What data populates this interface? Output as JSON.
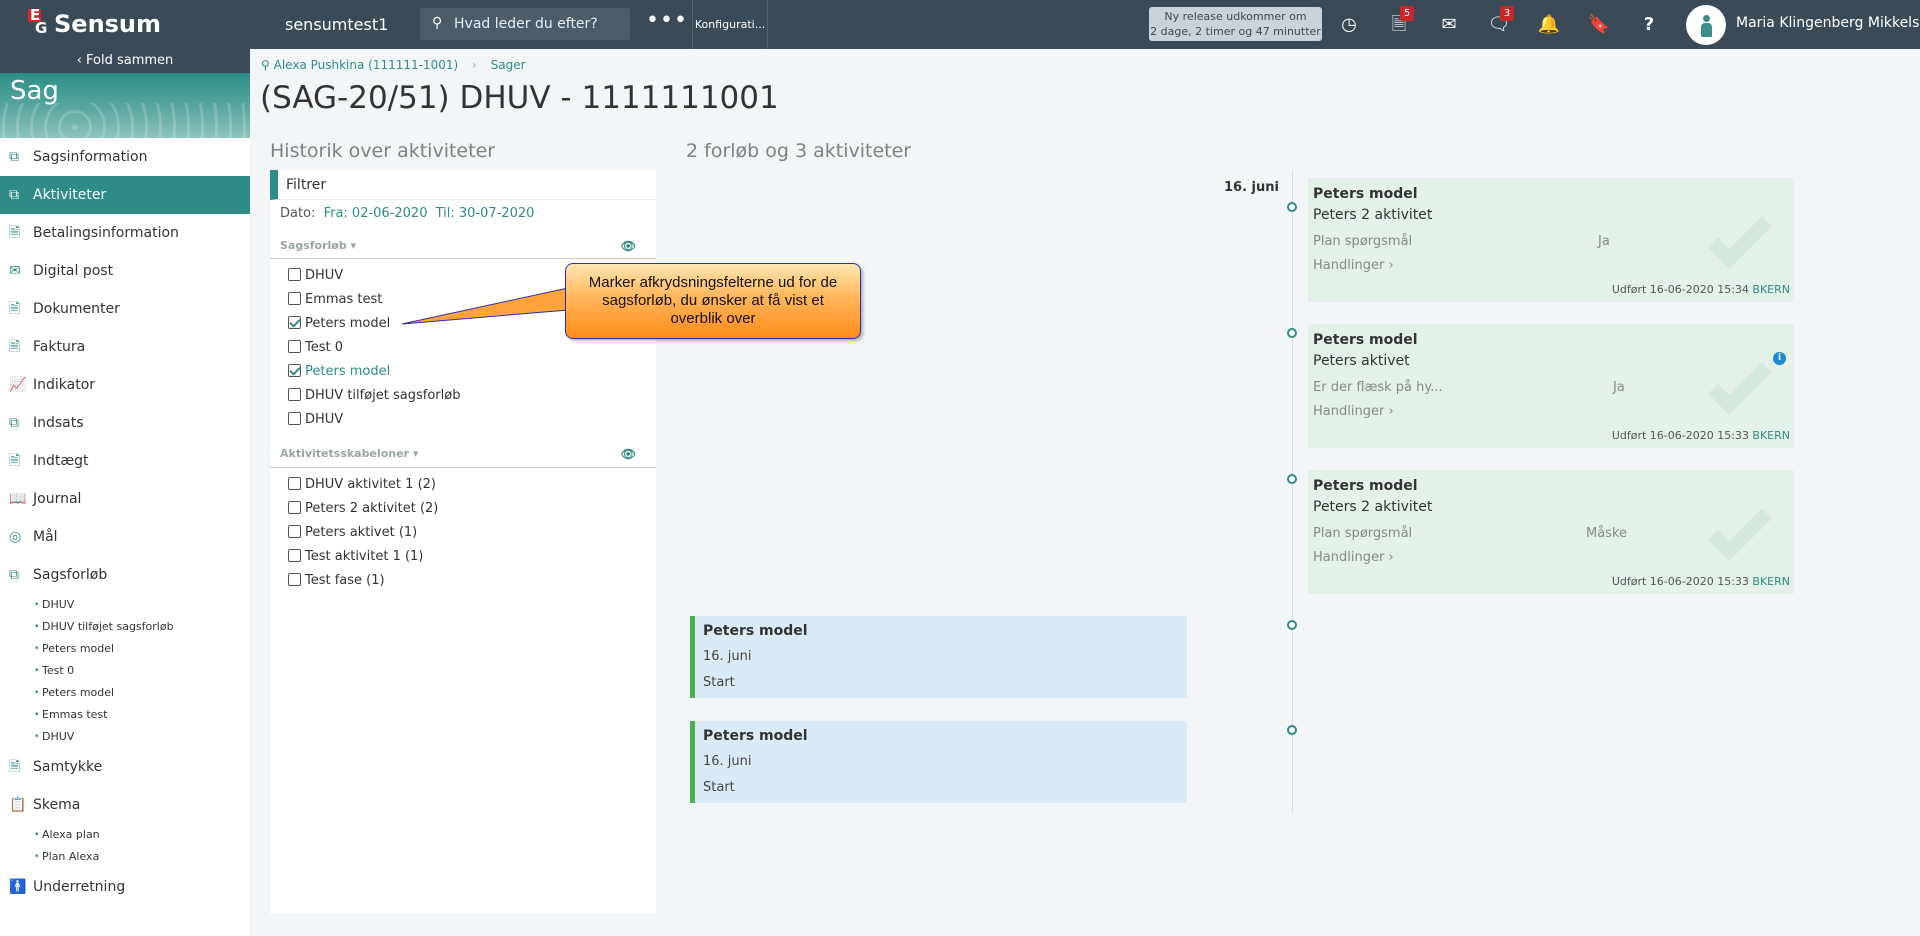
{
  "topbar": {
    "logo_e": "E",
    "logo_g": "G",
    "brand": "Sensum",
    "tenant": "sensumtest1",
    "search_placeholder": "Hvad leder du efter?",
    "more_label": "•••",
    "config_label": "Konfigurati...",
    "release_line1": "Ny release udkommer om",
    "release_line2": "2 dage, 2 timer og 47 minutter",
    "badge_docs": "5",
    "badge_chat": "3",
    "user_name": "Maria Klingenberg Mikkelsen",
    "icons": [
      "clock-icon",
      "document-icon",
      "mail-icon",
      "chat-icon",
      "bell-icon",
      "bookmark-icon",
      "help-icon"
    ]
  },
  "sidebar": {
    "fold_label": "Fold sammen",
    "title": "Sag",
    "items": [
      {
        "label": "Sagsinformation",
        "icon": "scroll-icon"
      },
      {
        "label": "Aktiviteter",
        "icon": "scroll-icon",
        "active": true
      },
      {
        "label": "Betalingsinformation",
        "icon": "document-icon"
      },
      {
        "label": "Digital post",
        "icon": "mail-icon"
      },
      {
        "label": "Dokumenter",
        "icon": "document-icon"
      },
      {
        "label": "Faktura",
        "icon": "document-icon"
      },
      {
        "label": "Indikator",
        "icon": "chart-icon"
      },
      {
        "label": "Indsats",
        "icon": "scroll-icon"
      },
      {
        "label": "Indtægt",
        "icon": "document-icon"
      },
      {
        "label": "Journal",
        "icon": "book-icon"
      },
      {
        "label": "Mål",
        "icon": "target-icon"
      },
      {
        "label": "Sagsforløb",
        "icon": "scroll-icon"
      },
      {
        "label": "Samtykke",
        "icon": "document-icon"
      },
      {
        "label": "Skema",
        "icon": "clipboard-icon"
      },
      {
        "label": "Underretning",
        "icon": "person-icon"
      }
    ],
    "sagsforloeb_sub": [
      "DHUV",
      "DHUV tilføjet sagsforløb",
      "Peters model",
      "Test 0",
      "Peters model",
      "Emmas test",
      "DHUV"
    ],
    "skema_sub": [
      "Alexa plan",
      "Plan Alexa"
    ]
  },
  "breadcrumb": {
    "person": "Alexa Pushkina (111111-1001)",
    "current": "Sager"
  },
  "page_title": "(SAG-20/51) DHUV - 1111111001",
  "history_title": "Historik over aktiviteter",
  "summary_title": "2 forløb og 3 aktiviteter",
  "filter": {
    "tab_label": "Filtrer",
    "date_label": "Dato:",
    "from": "Fra: 02-06-2020",
    "to": "Til: 30-07-2020",
    "section1": "Sagsforløb",
    "section2": "Aktivitetsskabeloner",
    "forloeb": [
      {
        "label": "DHUV",
        "checked": false
      },
      {
        "label": "Emmas test",
        "checked": false
      },
      {
        "label": "Peters model",
        "checked": true
      },
      {
        "label": "Test 0",
        "checked": false
      },
      {
        "label": "Peters model",
        "checked": true
      },
      {
        "label": "DHUV tilføjet sagsforløb",
        "checked": false
      },
      {
        "label": "DHUV",
        "checked": false
      }
    ],
    "skabeloner": [
      {
        "label": "DHUV aktivitet 1 (2)",
        "checked": false
      },
      {
        "label": "Peters 2 aktivitet (2)",
        "checked": false
      },
      {
        "label": "Peters aktivet (1)",
        "checked": false
      },
      {
        "label": "Test aktivitet 1 (1)",
        "checked": false
      },
      {
        "label": "Test fase (1)",
        "checked": false
      }
    ]
  },
  "callout": {
    "line1": "Marker afkrydsningsfelterne ud for de",
    "line2": "sagsforløb, du ønsker at få vist et",
    "line3": "overblik over"
  },
  "timeline": {
    "date": "16. juni",
    "activities": [
      {
        "title": "Peters model",
        "name": "Peters 2 aktivitet",
        "field": "Plan spørgsmål",
        "value": "Ja",
        "actions": "Handlinger",
        "done": "Udført 16-06-2020 15:34",
        "user": "BKERN"
      },
      {
        "title": "Peters model",
        "name": "Peters aktivet",
        "field": "Er der flæsk på hy...",
        "value": "Ja",
        "actions": "Handlinger",
        "done": "Udført 16-06-2020 15:33",
        "user": "BKERN"
      },
      {
        "title": "Peters model",
        "name": "Peters 2 aktivitet",
        "field": "Plan spørgsmål",
        "value": "Måske",
        "actions": "Handlinger",
        "done": "Udført 16-06-2020 15:33",
        "user": "BKERN"
      }
    ],
    "courses": [
      {
        "title": "Peters model",
        "date": "16. juni",
        "status": "Start"
      },
      {
        "title": "Peters model",
        "date": "16. juni",
        "status": "Start"
      }
    ]
  }
}
